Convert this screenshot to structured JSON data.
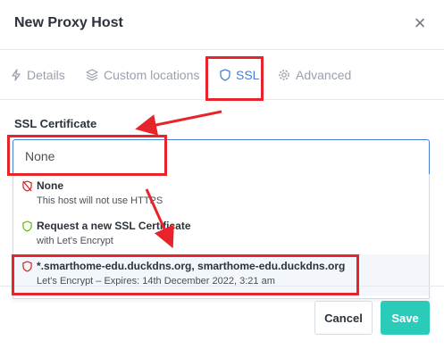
{
  "dialog": {
    "title": "New Proxy Host",
    "close_icon": "×"
  },
  "tabs": [
    {
      "label": "Details",
      "icon": "bolt-icon",
      "active": false
    },
    {
      "label": "Custom locations",
      "icon": "layers-icon",
      "active": false
    },
    {
      "label": "SSL",
      "icon": "shield-icon",
      "active": true
    },
    {
      "label": "Advanced",
      "icon": "gear-icon",
      "active": false
    }
  ],
  "ssl": {
    "label": "SSL Certificate",
    "selected_value": "None",
    "options": [
      {
        "title": "None",
        "subtitle": "This host will not use HTTPS",
        "icon": "shield-off-icon",
        "icon_color": "#cd201f"
      },
      {
        "title": "Request a new SSL Certificate",
        "subtitle": "with Let's Encrypt",
        "icon": "shield-icon",
        "icon_color": "#5eba00"
      },
      {
        "title": "*.smarthome-edu.duckdns.org, smarthome-edu.duckdns.org",
        "subtitle": "Let's Encrypt – Expires: 14th December 2022, 3:21 am",
        "icon": "shield-icon",
        "icon_color": "#cd201f"
      }
    ]
  },
  "footer": {
    "cancel_label": "Cancel",
    "save_label": "Save"
  },
  "colors": {
    "accent": "#467fcf",
    "save": "#2bcbba",
    "annotation": "#e8242b"
  }
}
